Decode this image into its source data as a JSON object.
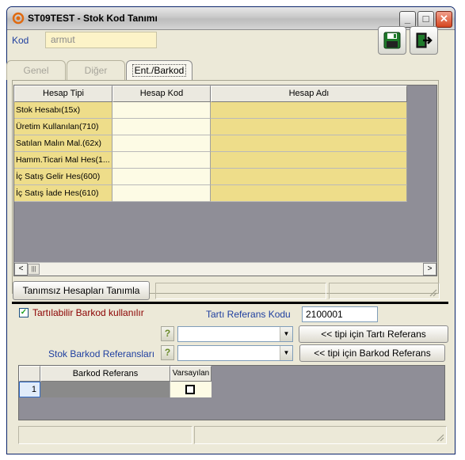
{
  "window": {
    "title": "ST09TEST - Stok Kod Tanımı",
    "controls": {
      "minimize": "_",
      "maximize": "□",
      "close": "✕"
    }
  },
  "kod": {
    "label": "Kod",
    "value": "armut"
  },
  "toolbar": {
    "save_icon": "floppy-disk-icon",
    "exit_icon": "exit-door-icon"
  },
  "tabs": [
    {
      "label": "Genel",
      "active": false
    },
    {
      "label": "Diğer",
      "active": false
    },
    {
      "label": "Ent./Barkod",
      "active": true
    }
  ],
  "accounts_grid": {
    "columns": [
      "Hesap Tipi",
      "Hesap Kod",
      "Hesap Adı"
    ],
    "rows": [
      {
        "tip": "Stok Hesabı(15x)",
        "kod": "",
        "ad": ""
      },
      {
        "tip": "Üretim Kullanılan(710)",
        "kod": "",
        "ad": ""
      },
      {
        "tip": "Satılan Malın Mal.(62x)",
        "kod": "",
        "ad": ""
      },
      {
        "tip": "Hamm.Ticari Mal Hes(1...",
        "kod": "",
        "ad": ""
      },
      {
        "tip": "İç Satış Gelir Hes(600)",
        "kod": "",
        "ad": ""
      },
      {
        "tip": "İç Satış İade Hes(610)",
        "kod": "",
        "ad": ""
      }
    ],
    "scroll_left": "<",
    "scroll_thumb": "|||",
    "scroll_right": ">"
  },
  "undefined_accounts_button": "Tanımsız Hesapları Tanımla",
  "barcode": {
    "checkbox_label": "Tartılabilir Barkod kullanılır",
    "checkbox_checked": true,
    "checkbox_mark": "✓",
    "tarti_label": "Tartı Referans Kodu",
    "tarti_value": "2100001",
    "help_glyph": "?",
    "combo1_value": "",
    "combo2_value": "",
    "combo_arrow": "▼",
    "tarti_button": "<< tipi için Tartı Referans",
    "barkod_button": "<< tipi için Barkod Referans",
    "stok_barkod_label": "Stok Barkod Referansları"
  },
  "barcode_grid": {
    "columns": [
      "Barkod Referans",
      "Varsayılan"
    ],
    "rows": [
      {
        "num": "1",
        "ref": "",
        "default": false
      }
    ]
  },
  "colors": {
    "label_blue": "#2040a0",
    "checkbox_label": "#8b0000",
    "grid_yellow": "#eedd8a",
    "grid_cream": "#fdfbe5",
    "grid_bg": "#8f8e97"
  }
}
